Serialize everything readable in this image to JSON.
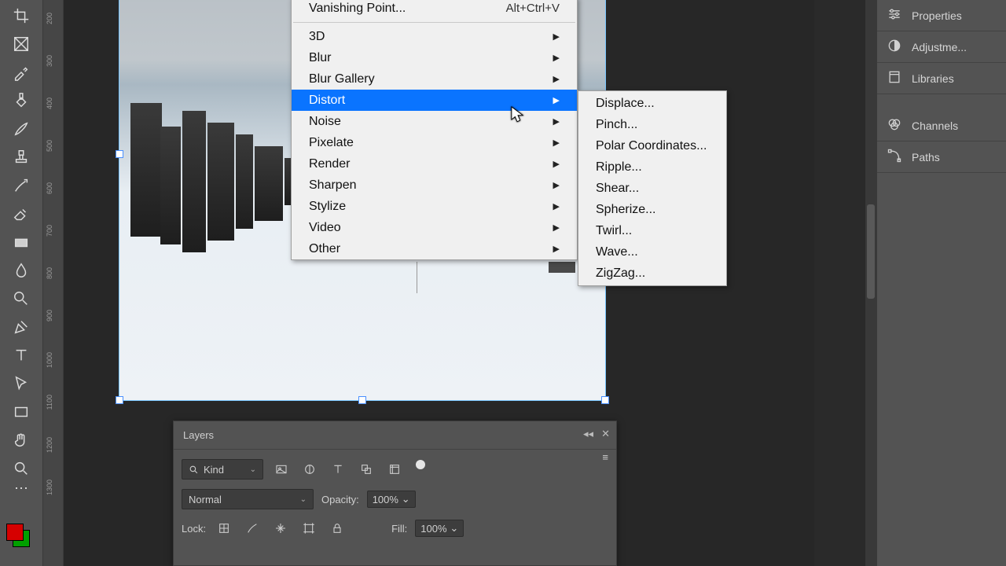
{
  "ruler": {
    "ticks": [
      "200",
      "300",
      "400",
      "500",
      "600",
      "700",
      "800",
      "900",
      "1000",
      "1100",
      "1200",
      "1300"
    ]
  },
  "menu_primary": {
    "vanishing": {
      "label": "Vanishing Point...",
      "shortcut": "Alt+Ctrl+V"
    },
    "groups": [
      {
        "label": "3D",
        "sub": true
      },
      {
        "label": "Blur",
        "sub": true
      },
      {
        "label": "Blur Gallery",
        "sub": true
      },
      {
        "label": "Distort",
        "sub": true,
        "highlight": true
      },
      {
        "label": "Noise",
        "sub": true
      },
      {
        "label": "Pixelate",
        "sub": true
      },
      {
        "label": "Render",
        "sub": true
      },
      {
        "label": "Sharpen",
        "sub": true
      },
      {
        "label": "Stylize",
        "sub": true
      },
      {
        "label": "Video",
        "sub": true
      },
      {
        "label": "Other",
        "sub": true
      }
    ]
  },
  "submenu_distort": [
    "Displace...",
    "Pinch...",
    "Polar Coordinates...",
    "Ripple...",
    "Shear...",
    "Spherize...",
    "Twirl...",
    "Wave...",
    "ZigZag..."
  ],
  "right_panel": [
    {
      "icon": "sliders",
      "label": "Properties"
    },
    {
      "icon": "circle-half",
      "label": "Adjustme..."
    },
    {
      "icon": "book",
      "label": "Libraries"
    },
    {
      "icon": "rgb",
      "label": "Channels"
    },
    {
      "icon": "pen-path",
      "label": "Paths"
    }
  ],
  "layers_panel": {
    "title": "Layers",
    "kind_label": "Kind",
    "blend_mode": "Normal",
    "opacity_label": "Opacity:",
    "opacity_value": "100%",
    "lock_label": "Lock:",
    "fill_label": "Fill:",
    "fill_value": "100%"
  }
}
